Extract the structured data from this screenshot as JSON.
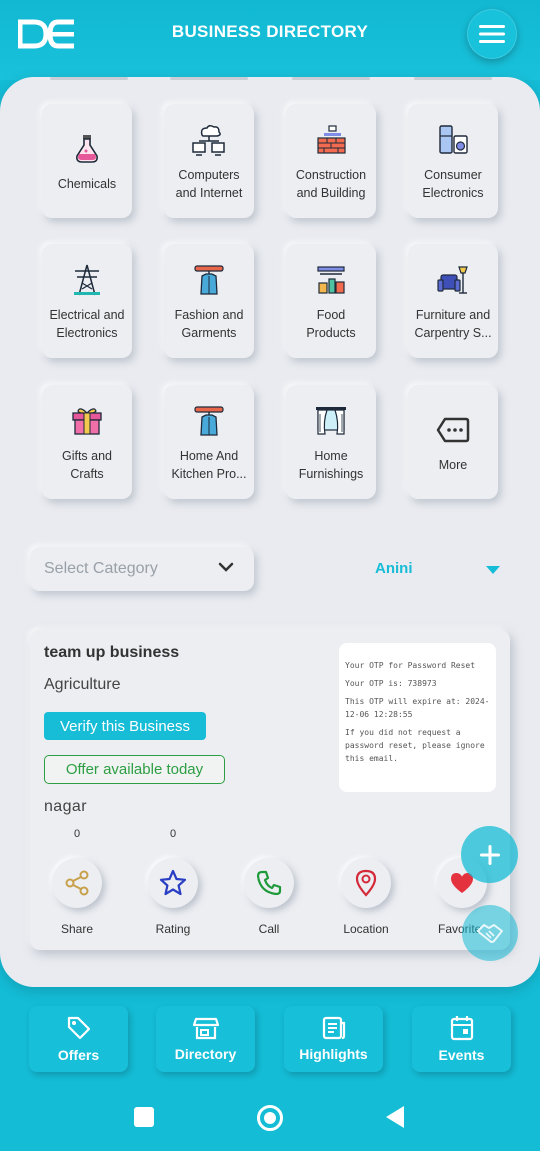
{
  "header": {
    "logo_text": "DE",
    "title": "BUSINESS DIRECTORY",
    "menu_icon": "hamburger-menu-icon"
  },
  "categories": [
    {
      "label": "Chemicals",
      "icon": "chemical-flask-icon"
    },
    {
      "label": "Computers\nand Internet",
      "icon": "computer-network-icon"
    },
    {
      "label": "Construction\nand Building",
      "icon": "brick-wall-icon"
    },
    {
      "label": "Consumer\nElectronics",
      "icon": "appliances-icon"
    },
    {
      "label": "Electrical and\nElectronics",
      "icon": "power-tower-icon"
    },
    {
      "label": "Fashion and\nGarments",
      "icon": "garment-hanger-icon"
    },
    {
      "label": "Food\nProducts",
      "icon": "food-shelf-icon"
    },
    {
      "label": "Furniture and\nCarpentry S...",
      "icon": "armchair-lamp-icon"
    },
    {
      "label": "Gifts and\nCrafts",
      "icon": "gift-box-icon"
    },
    {
      "label": "Home And\nKitchen Pro...",
      "icon": "apron-hanger-icon"
    },
    {
      "label": "Home\nFurnishings",
      "icon": "curtains-icon"
    },
    {
      "label": "More",
      "icon": "more-tag-icon"
    }
  ],
  "filters": {
    "category_placeholder": "Select Category",
    "location_value": "Anini"
  },
  "business": {
    "name": "team up business",
    "category": "Agriculture",
    "verify_label": "Verify this Business",
    "offer_label": "Offer available today",
    "area": "nagar",
    "share_count": "0",
    "rating_count": "0",
    "otp_lines": [
      "Your OTP for Password Reset",
      "Your OTP is: 738973",
      "This OTP will expire at: 2024-12-06 12:28:55",
      "If you did not request a password reset, please ignore this email."
    ]
  },
  "actions": [
    {
      "label": "Share",
      "icon": "share-icon"
    },
    {
      "label": "Rating",
      "icon": "star-icon"
    },
    {
      "label": "Call",
      "icon": "phone-icon"
    },
    {
      "label": "Location",
      "icon": "location-pin-icon"
    },
    {
      "label": "Favorite",
      "icon": "heart-icon"
    }
  ],
  "bottom_nav": [
    {
      "label": "Offers",
      "icon": "tag-icon"
    },
    {
      "label": "Directory",
      "icon": "store-icon"
    },
    {
      "label": "Highlights",
      "icon": "newspaper-icon"
    },
    {
      "label": "Events",
      "icon": "calendar-icon"
    }
  ],
  "colors": {
    "brand": "#17bcd6",
    "offer_green": "#2e9e44",
    "panel": "#e9ebf0"
  }
}
